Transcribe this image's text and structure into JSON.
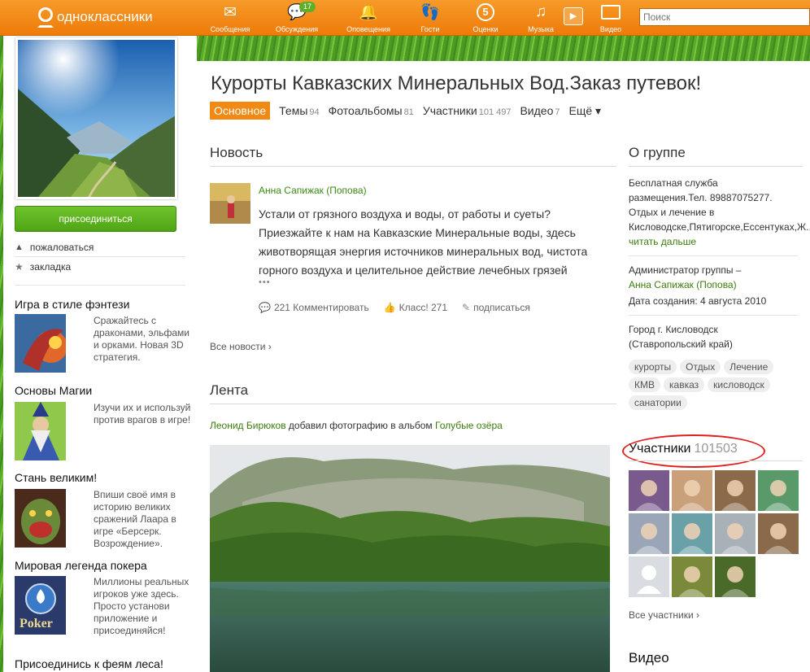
{
  "brand": {
    "name": "одноклассники"
  },
  "nav": [
    {
      "label": "Сообщения",
      "icon": "envelope-icon",
      "glyph": "✉"
    },
    {
      "label": "Обсуждения",
      "icon": "chat-icon",
      "glyph": "💬",
      "badge": "17"
    },
    {
      "label": "Оповещения",
      "icon": "bell-icon",
      "glyph": "🔔"
    },
    {
      "label": "Гости",
      "icon": "footprints-icon",
      "glyph": "👣"
    },
    {
      "label": "Оценки",
      "icon": "rating-icon",
      "glyph": "5"
    },
    {
      "label": "Музыка",
      "icon": "music-icon",
      "glyph": "♫"
    },
    {
      "label": "Видео",
      "icon": "video-icon",
      "glyph": "▭"
    }
  ],
  "search": {
    "placeholder": "Поиск"
  },
  "sidebar": {
    "join": "присоединиться",
    "complain": "пожаловаться",
    "bookmark": "закладка",
    "promos": [
      {
        "title": "Игра в стиле фэнтези",
        "text": "Сражайтесь с драконами, эльфами и орками. Новая 3D стратегия."
      },
      {
        "title": "Основы Магии",
        "text": "Изучи их и используй против врагов в игре!"
      },
      {
        "title": "Стань великим!",
        "text": "Впиши своё имя в историю великих сражений Лаара в игре «Берсерк. Возрождение»."
      },
      {
        "title": "Мировая легенда покера",
        "text": "Миллионы реальных игроков уже здесь. Просто установи приложение и присоединяйся!",
        "logo": "Poker"
      },
      {
        "title": "Присоединись к феям леса!"
      }
    ]
  },
  "group": {
    "title": "Курорты Кавказских Минеральных Вод.Заказ путевок!",
    "tabs": [
      {
        "label": "Основное",
        "count": ""
      },
      {
        "label": "Темы",
        "count": "94"
      },
      {
        "label": "Фотоальбомы",
        "count": "81"
      },
      {
        "label": "Участники",
        "count": "101 497"
      },
      {
        "label": "Видео",
        "count": "7"
      },
      {
        "label": "Ещё ▾",
        "count": ""
      }
    ]
  },
  "news": {
    "heading": "Новость",
    "author": "Анна Сапижак (Попова)",
    "text": "Устали от грязного воздуха и воды, от работы и суеты? Приезжайте к нам на Кавказские Минеральные воды, здесь животворящая энергия источников минеральных вод, чистота горного воздуха и целительное действие лечебных грязей",
    "more": "•••",
    "comments": "221 Комментировать",
    "likes": "Класс! 271",
    "subscribe": "подписаться",
    "all_news": "Все новости ›"
  },
  "feed": {
    "heading": "Лента",
    "user": "Леонид Бирюков",
    "action": " добавил фотографию в альбом ",
    "album": "Голубые озёра"
  },
  "about": {
    "heading": "О группе",
    "description": "Бесплатная служба размещения.Тел. 89887075277. Отдых и лечение в Кисловодске,Пятигорске,Ессентуках,Ж...",
    "read_more": "читать дальше",
    "admin_label": "Администратор группы –",
    "admin_name": "Анна Сапижак (Попова)",
    "created": "Дата создания: 4 августа 2010",
    "city": "Город г. Кисловодск (Ставропольский край)",
    "tags": [
      "курорты",
      "Отдых",
      "Лечение",
      "КМВ",
      "кавказ",
      "кисловодск",
      "санатории"
    ]
  },
  "members": {
    "heading": "Участники",
    "count": "101503",
    "all": "Все участники ›",
    "tile_colors": [
      "#7a5a8c",
      "#c9a07a",
      "#8b6a4a",
      "#5a9a6a",
      "#9aa6b8",
      "#6aa0a8",
      "#a8b0b8",
      "#8a6a4a",
      "#d4d8dc",
      "#7a8a3a",
      "#4a6a2a"
    ]
  },
  "video": {
    "heading": "Видео"
  },
  "colors": {
    "accent": "#f08a14",
    "link": "#3b8a14",
    "join": "#5bb31e",
    "highlight": "#e02020"
  }
}
